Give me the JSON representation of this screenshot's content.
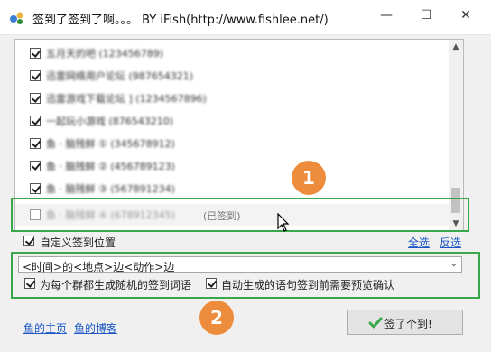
{
  "window": {
    "title": "签到了签到了啊。。。 BY iFish(http://www.fishlee.net/)",
    "controls": {
      "minimize": "—",
      "maximize": "☐",
      "close": "✕"
    }
  },
  "list": {
    "rows": [
      {
        "text": "五月天的吧 (123456789)",
        "checked": true
      },
      {
        "text": "迅雷网络用户论坛 (987654321)",
        "checked": true
      },
      {
        "text": "迅雷游戏下载论坛 ] (1234567896)",
        "checked": true
      },
      {
        "text": "一起玩小游戏 (876543210)",
        "checked": true
      },
      {
        "text": "鱼 · 脑残鲜 ① (345678912)",
        "checked": true
      },
      {
        "text": "鱼 · 脑残鲜 ② (456789123)",
        "checked": true
      },
      {
        "text": "鱼 · 脑残鲜 ③ (567891234)",
        "checked": true
      },
      {
        "text": "鱼 · 脑残鲜 ④ (678912345)",
        "checked": false,
        "status": "(已签到)"
      }
    ]
  },
  "badges": {
    "one": "1",
    "two": "2"
  },
  "custom_location": {
    "label": "自定义签到位置",
    "checked": true
  },
  "links": {
    "select_all": "全选",
    "invert": "反选",
    "home": "鱼的主页",
    "blog": "鱼的博客"
  },
  "template": {
    "value": "<时间>的<地点>边<动作>边"
  },
  "options": {
    "random_words": {
      "label": "为每个群都生成随机的签到词语",
      "checked": true
    },
    "preview_confirm": {
      "label": "自动生成的语句签到前需要预览确认",
      "checked": true
    }
  },
  "sign_button": {
    "label": "签了个到!"
  },
  "icons": {
    "app": "app-logo-icon",
    "check": "check-icon",
    "cursor": "mouse-cursor-icon"
  },
  "colors": {
    "highlight": "#3aa84a",
    "badge": "#ee8c3e",
    "link": "#1b57c6"
  }
}
